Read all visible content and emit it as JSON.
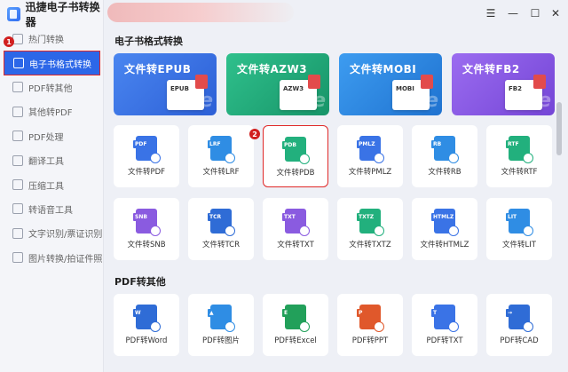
{
  "app": {
    "name": "迅捷电子书转换器"
  },
  "sidebar": {
    "items": [
      {
        "label": "热门转换",
        "active": false
      },
      {
        "label": "电子书格式转换",
        "active": true
      },
      {
        "label": "PDF转其他",
        "active": false
      },
      {
        "label": "其他转PDF",
        "active": false
      },
      {
        "label": "PDF处理",
        "active": false
      },
      {
        "label": "翻译工具",
        "active": false
      },
      {
        "label": "压缩工具",
        "active": false
      },
      {
        "label": "转语音工具",
        "active": false
      },
      {
        "label": "文字识别/票证识别",
        "active": false
      },
      {
        "label": "图片转换/拍证件照",
        "active": false
      }
    ],
    "badge": "1"
  },
  "window": {
    "menu_icon": "☰",
    "minimize": "—",
    "maximize": "☐",
    "close": "✕"
  },
  "ebook_section": {
    "title": "电子书格式转换",
    "banners": [
      {
        "label": "文件转EPUB",
        "tag": "EPUB",
        "color": "#3a73e6"
      },
      {
        "label": "文件转AZW3",
        "tag": "AZW3",
        "color": "#22b07d"
      },
      {
        "label": "文件转MOBI",
        "tag": "MOBI",
        "color": "#2f8de4"
      },
      {
        "label": "文件转FB2",
        "tag": "FB2",
        "color": "#8a5be0"
      }
    ],
    "cards": [
      {
        "tag": "PDF",
        "label": "文件转PDF",
        "color": "#3a73e6"
      },
      {
        "tag": "LRF",
        "label": "文件转LRF",
        "color": "#2f8de4"
      },
      {
        "tag": "PDB",
        "label": "文件转PDB",
        "color": "#22b07d",
        "selected": true
      },
      {
        "tag": "PMLZ",
        "label": "文件转PMLZ",
        "color": "#3a73e6"
      },
      {
        "tag": "RB",
        "label": "文件转RB",
        "color": "#2f8de4"
      },
      {
        "tag": "RTF",
        "label": "文件转RTF",
        "color": "#22b07d"
      },
      {
        "tag": "SNB",
        "label": "文件转SNB",
        "color": "#8a5be0"
      },
      {
        "tag": "TCR",
        "label": "文件转TCR",
        "color": "#2f6cd6"
      },
      {
        "tag": "TXT",
        "label": "文件转TXT",
        "color": "#8a5be0"
      },
      {
        "tag": "TXTZ",
        "label": "文件转TXTZ",
        "color": "#22b07d"
      },
      {
        "tag": "HTMLZ",
        "label": "文件转HTMLZ",
        "color": "#3a73e6"
      },
      {
        "tag": "LIT",
        "label": "文件转LIT",
        "color": "#2f8de4"
      }
    ],
    "badge": "2"
  },
  "pdf_section": {
    "title": "PDF转其他",
    "cards": [
      {
        "tag": "W",
        "label": "PDF转Word",
        "color": "#2f6cd6"
      },
      {
        "tag": "▲",
        "label": "PDF转图片",
        "color": "#2f8de4"
      },
      {
        "tag": "E",
        "label": "PDF转Excel",
        "color": "#22a05a"
      },
      {
        "tag": "P",
        "label": "PDF转PPT",
        "color": "#e0582b"
      },
      {
        "tag": "T",
        "label": "PDF转TXT",
        "color": "#3a73e6"
      },
      {
        "tag": "→",
        "label": "PDF转CAD",
        "color": "#2f6cd6"
      }
    ]
  }
}
